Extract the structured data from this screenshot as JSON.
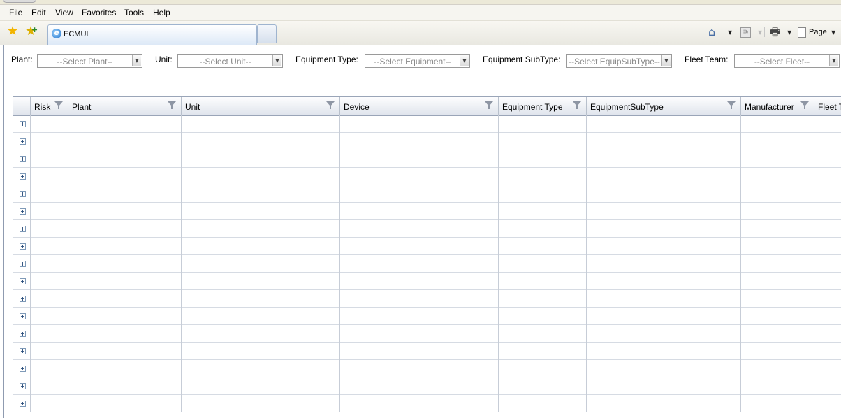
{
  "menu": [
    "File",
    "Edit",
    "View",
    "Favorites",
    "Tools",
    "Help"
  ],
  "tab": {
    "title": "ECMUI"
  },
  "commandbar": {
    "page_label": "Page"
  },
  "filters": [
    {
      "label": "Plant:",
      "placeholder": "--Select Plant--"
    },
    {
      "label": "Unit:",
      "placeholder": "--Select Unit--"
    },
    {
      "label": "Equipment Type:",
      "placeholder": "--Select Equipment--"
    },
    {
      "label": "Equipment SubType:",
      "placeholder": "--Select EquipSubType--"
    },
    {
      "label": "Fleet Team:",
      "placeholder": "--Select Fleet--"
    }
  ],
  "grid": {
    "columns": [
      "Risk",
      "Plant",
      "Unit",
      "Device",
      "Equipment Type",
      "EquipmentSubType",
      "Manufacturer",
      "Fleet T"
    ],
    "row_count": 17
  }
}
